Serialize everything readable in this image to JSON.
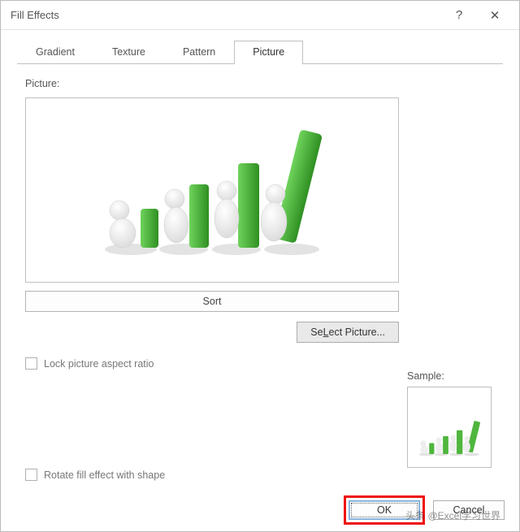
{
  "window": {
    "title": "Fill Effects",
    "help_icon": "?",
    "close_icon": "✕"
  },
  "tabs": {
    "items": [
      {
        "label": "Gradient"
      },
      {
        "label": "Texture"
      },
      {
        "label": "Pattern"
      },
      {
        "label": "Picture"
      }
    ],
    "active_index": 3
  },
  "picture_tab": {
    "picture_label": "Picture:",
    "sort_button": "Sort",
    "select_picture_button": "Select Picture...",
    "select_picture_accel": "L",
    "lock_aspect_label": "Lock picture aspect ratio",
    "rotate_label": "Rotate fill effect with shape",
    "sample_label": "Sample:"
  },
  "buttons": {
    "ok": "OK",
    "cancel": "Cancel"
  },
  "watermark": "头条 @Excel学习世界",
  "colors": {
    "bar_green": "#3fab2f",
    "bar_green_light": "#6fd35c",
    "figure_gray": "#e8e8e8",
    "figure_shadow": "#cfcfcf"
  }
}
